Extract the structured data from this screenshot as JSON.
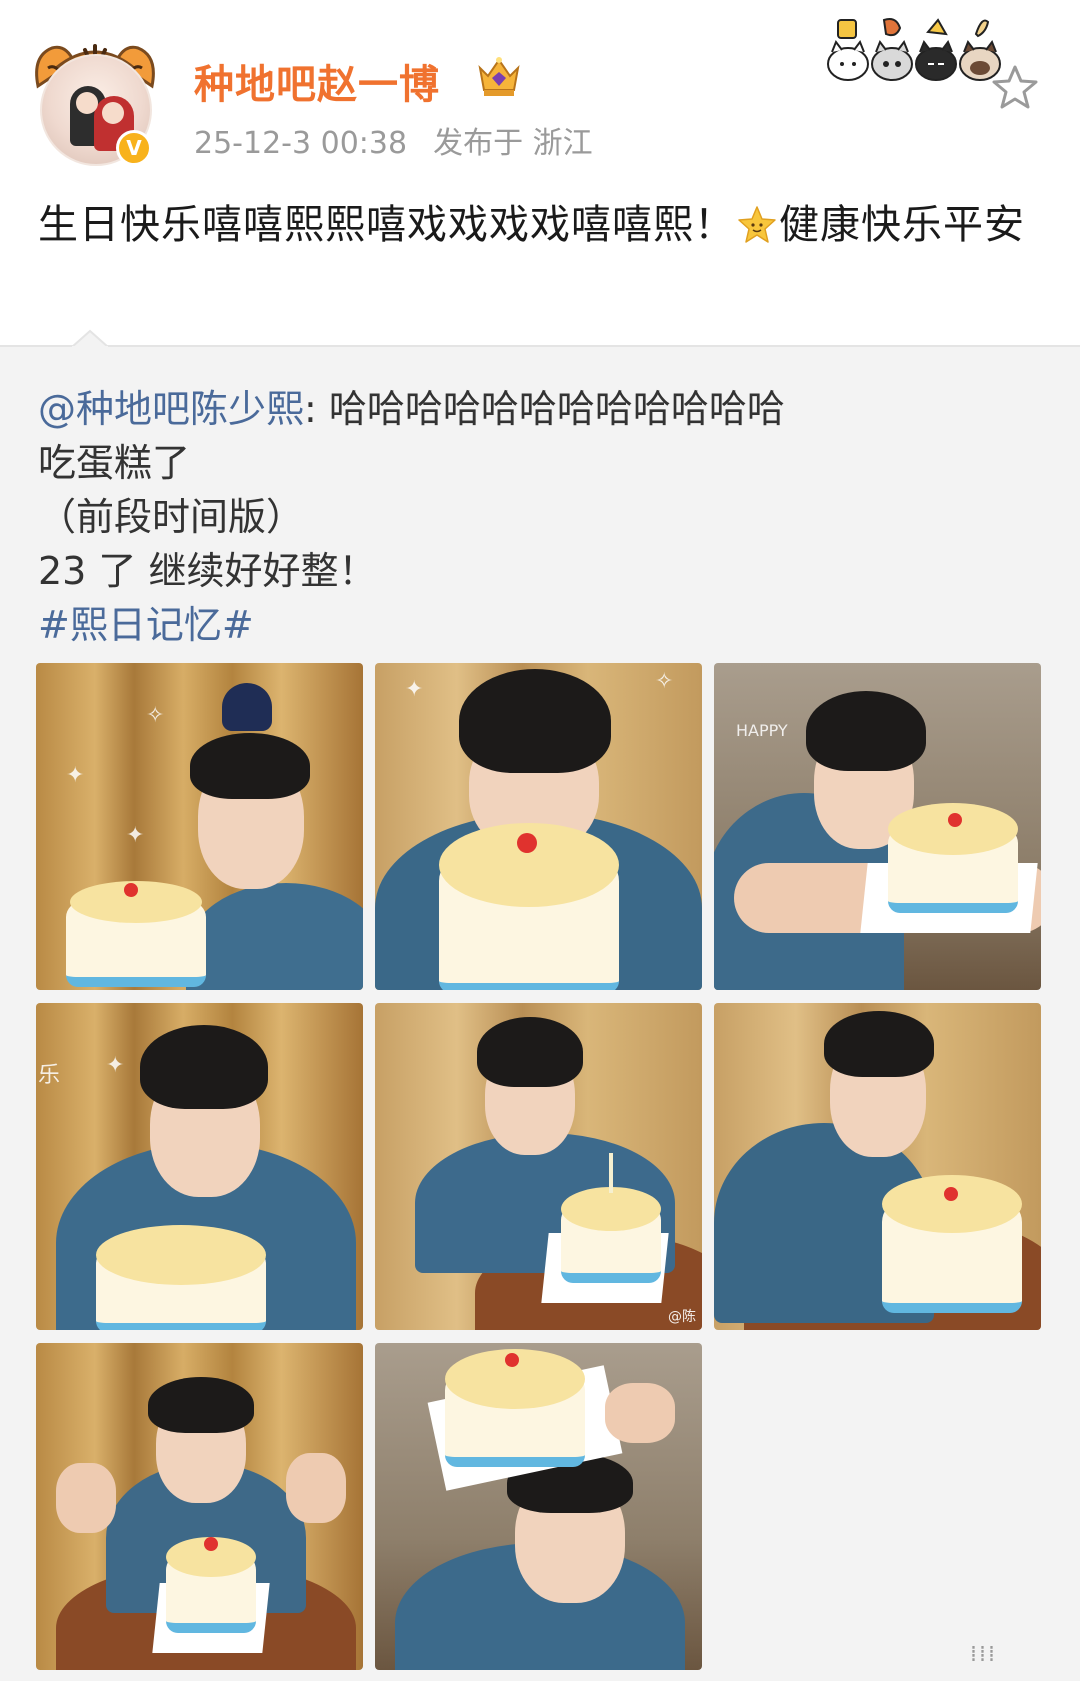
{
  "post": {
    "username": "种地吧赵一博",
    "datetime": "25-12-3 00:38",
    "location": "发布于 浙江",
    "text_part1": "生日快乐嘻嘻熙熙嘻戏戏戏戏嘻嘻熙！",
    "text_part2": "健康快乐平安",
    "verified_color": "#f8b21c",
    "username_color": "#f0722f"
  },
  "repost": {
    "mention": "@种地吧陈少熙",
    "line1_rest": ": 哈哈哈哈哈哈哈哈哈哈哈哈",
    "line2": "吃蛋糕了",
    "line3": "（前段时间版）",
    "line4": "23 了 继续好好整！",
    "hashtag": "#熙日记忆#",
    "link_color": "#4a6a9a"
  },
  "photos": {
    "count": 8,
    "watermark": "@陈"
  }
}
